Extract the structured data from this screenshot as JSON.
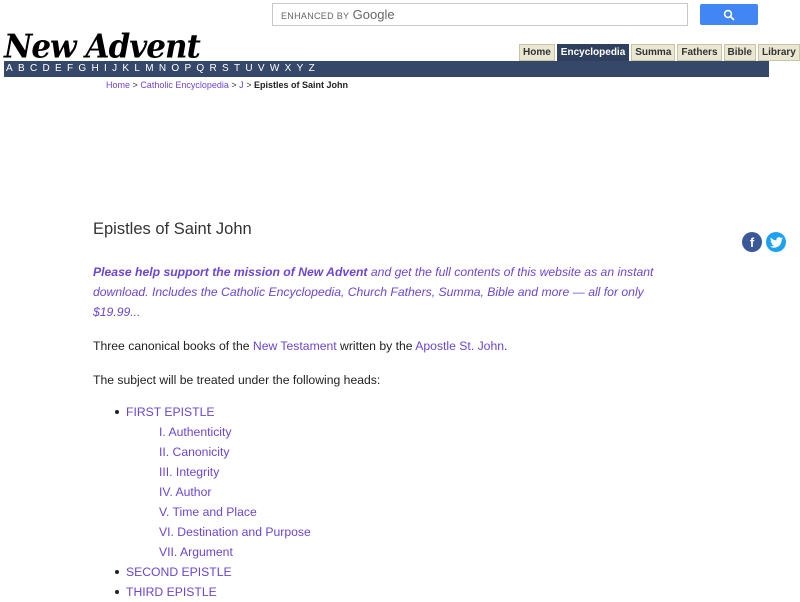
{
  "search": {
    "brand_prefix": "ENHANCED BY",
    "brand_name": "Google"
  },
  "logo": "New Advent",
  "topnav": [
    "Home",
    "Encyclopedia",
    "Summa",
    "Fathers",
    "Bible",
    "Library"
  ],
  "alphabet": [
    "A",
    "B",
    "C",
    "D",
    "E",
    "F",
    "G",
    "H",
    "I",
    "J",
    "K",
    "L",
    "M",
    "N",
    "O",
    "P",
    "Q",
    "R",
    "S",
    "T",
    "U",
    "V",
    "W",
    "X",
    "Y",
    "Z"
  ],
  "breadcrumb": {
    "home": "Home",
    "sep": ">",
    "encyclopedia": "Catholic Encyclopedia",
    "letter": "J",
    "current": "Epistles of Saint John"
  },
  "article": {
    "title": "Epistles of Saint John",
    "support_bold": "Please help support the mission of New Advent",
    "support_rest": " and get the full contents of this website as an instant download. Includes the Catholic Encyclopedia, Church Fathers, Summa, Bible and more — all for only $19.99...",
    "intro_1": "Three canonical books of the ",
    "intro_link1": "New Testament",
    "intro_2": " written by the ",
    "intro_link2": "Apostle St. John",
    "intro_3": ".",
    "heads_intro": "The subject will be treated under the following heads:",
    "first": "FIRST EPISTLE",
    "first_sub": [
      "I. Authenticity",
      "II. Canonicity",
      "III. Integrity",
      "IV. Author",
      "V. Time and Place",
      "VI. Destination and Purpose",
      "VII. Argument"
    ],
    "second": "SECOND EPISTLE",
    "third": "THIRD EPISTLE"
  },
  "social": {
    "facebook": "f",
    "twitter": "t"
  }
}
